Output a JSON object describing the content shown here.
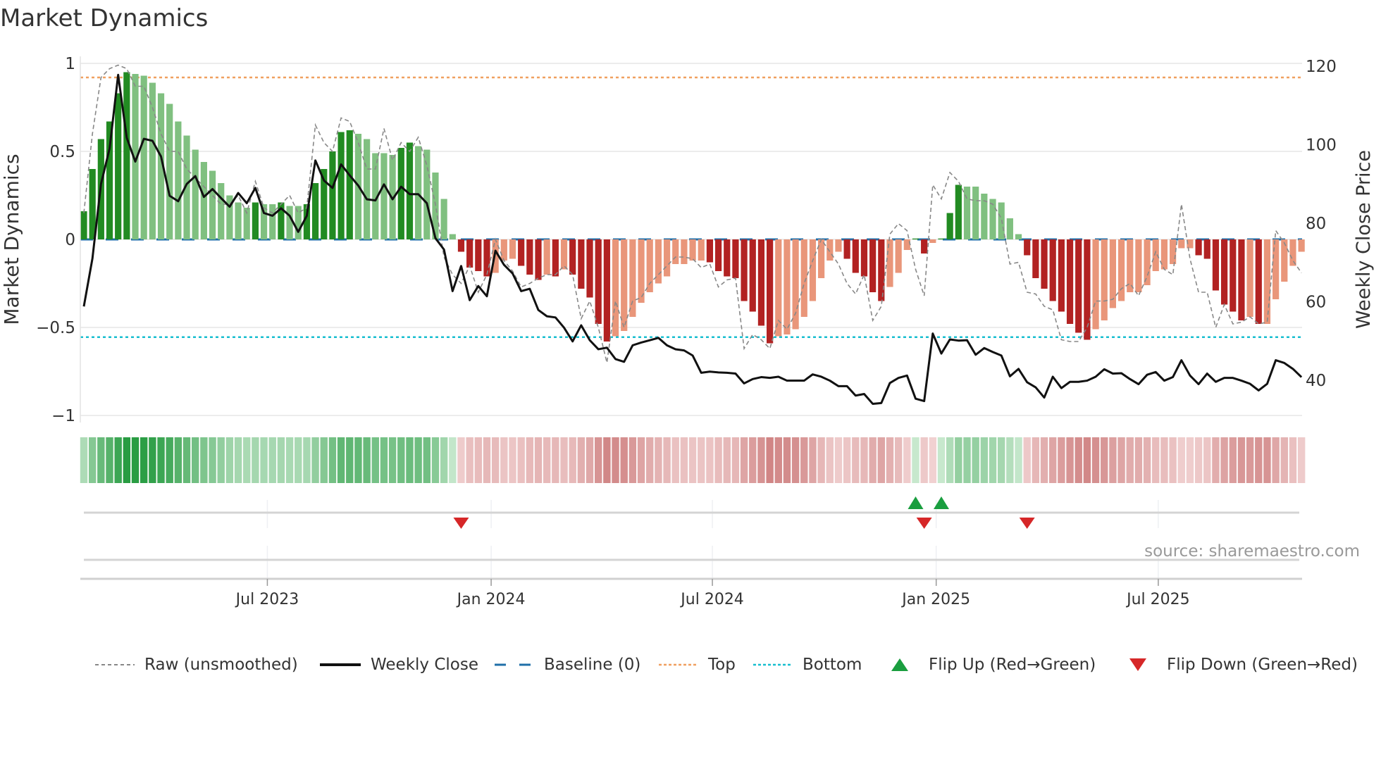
{
  "title": "Market Dynamics",
  "source": "source: sharemaestro.com",
  "legend": {
    "raw": "Raw (unsmoothed)",
    "close": "Weekly Close",
    "baseline": "Baseline (0)",
    "top": "Top",
    "bottom": "Bottom",
    "flip_up": "Flip Up (Red→Green)",
    "flip_down": "Flip Down (Green→Red)"
  },
  "colors": {
    "green_dark": "#228b22",
    "green_light": "#80c080",
    "red_dark": "#b22222",
    "red_light": "#e9967a",
    "top": "#f0a060",
    "bottom": "#17becf",
    "baseline": "#1f6fa8",
    "raw": "#888888",
    "close": "#111111",
    "flip_up": "#1a9e3f",
    "flip_down": "#d62728"
  },
  "chart_data": {
    "type": "bar",
    "title": "Market Dynamics",
    "xlabel": "",
    "ylabel": "Market Dynamics",
    "y2label": "Weekly Close Price",
    "ylim": [
      -1,
      1
    ],
    "y2lim": [
      40,
      120
    ],
    "yticks": [
      {
        "v": 1,
        "label": "1"
      },
      {
        "v": 0.5,
        "label": "0.5"
      },
      {
        "v": 0,
        "label": "0"
      },
      {
        "v": -0.5,
        "label": "−0.5"
      },
      {
        "v": -1,
        "label": "−1"
      }
    ],
    "y2ticks": [
      {
        "v": 120,
        "label": "120"
      },
      {
        "v": 100,
        "label": "100"
      },
      {
        "v": 80,
        "label": "80"
      },
      {
        "v": 60,
        "label": "60"
      },
      {
        "v": 40,
        "label": "40"
      }
    ],
    "xticks": [
      {
        "week": 21.4,
        "label": "Jul 2023"
      },
      {
        "week": 47.5,
        "label": "Jan 2024"
      },
      {
        "week": 73.3,
        "label": "Jul 2024"
      },
      {
        "week": 99.4,
        "label": "Jan 2025"
      },
      {
        "week": 125.3,
        "label": "Jul 2025"
      }
    ],
    "top_level": 0.92,
    "bottom_level": -0.555,
    "baseline": 0,
    "dynamics": [
      0.16,
      0.4,
      0.57,
      0.67,
      0.83,
      0.95,
      0.94,
      0.93,
      0.89,
      0.83,
      0.77,
      0.67,
      0.59,
      0.51,
      0.44,
      0.39,
      0.32,
      0.25,
      0.21,
      0.18,
      0.21,
      0.2,
      0.2,
      0.21,
      0.19,
      0.19,
      0.2,
      0.32,
      0.4,
      0.5,
      0.61,
      0.62,
      0.6,
      0.57,
      0.49,
      0.49,
      0.48,
      0.52,
      0.55,
      0.53,
      0.51,
      0.38,
      0.23,
      0.03,
      -0.07,
      -0.16,
      -0.18,
      -0.21,
      -0.19,
      -0.12,
      -0.11,
      -0.15,
      -0.2,
      -0.23,
      -0.2,
      -0.21,
      -0.17,
      -0.2,
      -0.28,
      -0.33,
      -0.48,
      -0.58,
      -0.55,
      -0.52,
      -0.44,
      -0.36,
      -0.3,
      -0.25,
      -0.21,
      -0.14,
      -0.14,
      -0.12,
      -0.12,
      -0.13,
      -0.18,
      -0.21,
      -0.22,
      -0.35,
      -0.41,
      -0.49,
      -0.59,
      -0.55,
      -0.54,
      -0.51,
      -0.44,
      -0.35,
      -0.22,
      -0.12,
      -0.07,
      -0.11,
      -0.19,
      -0.21,
      -0.3,
      -0.35,
      -0.27,
      -0.19,
      -0.06,
      0.005,
      -0.08,
      -0.02,
      0.005,
      0.15,
      0.31,
      0.3,
      0.3,
      0.26,
      0.23,
      0.21,
      0.12,
      0.03,
      -0.09,
      -0.22,
      -0.28,
      -0.35,
      -0.41,
      -0.48,
      -0.53,
      -0.57,
      -0.51,
      -0.46,
      -0.39,
      -0.35,
      -0.3,
      -0.3,
      -0.26,
      -0.18,
      -0.17,
      -0.14,
      -0.05,
      -0.05,
      -0.09,
      -0.11,
      -0.29,
      -0.37,
      -0.41,
      -0.46,
      -0.44,
      -0.48,
      -0.48,
      -0.34,
      -0.24,
      -0.15,
      -0.07
    ],
    "raw": [
      0.15,
      0.6,
      0.92,
      0.97,
      0.99,
      0.97,
      0.87,
      0.87,
      0.75,
      0.6,
      0.5,
      0.5,
      0.4,
      0.35,
      0.3,
      0.25,
      0.2,
      0.2,
      0.25,
      0.15,
      0.33,
      0.18,
      0.15,
      0.2,
      0.25,
      0.15,
      0.18,
      0.65,
      0.55,
      0.5,
      0.69,
      0.67,
      0.55,
      0.4,
      0.4,
      0.63,
      0.45,
      0.55,
      0.5,
      0.58,
      0.42,
      0.2,
      -0.1,
      -0.2,
      -0.25,
      -0.15,
      -0.3,
      -0.2,
      0.0,
      -0.12,
      -0.18,
      -0.27,
      -0.25,
      -0.22,
      -0.2,
      -0.2,
      -0.15,
      -0.2,
      -0.45,
      -0.35,
      -0.5,
      -0.7,
      -0.35,
      -0.5,
      -0.35,
      -0.33,
      -0.25,
      -0.2,
      -0.15,
      -0.1,
      -0.1,
      -0.11,
      -0.16,
      -0.14,
      -0.27,
      -0.23,
      -0.22,
      -0.62,
      -0.54,
      -0.57,
      -0.62,
      -0.46,
      -0.51,
      -0.42,
      -0.25,
      -0.12,
      0.0,
      -0.07,
      -0.14,
      -0.25,
      -0.31,
      -0.2,
      -0.46,
      -0.38,
      0.03,
      0.09,
      0.05,
      -0.17,
      -0.32,
      0.31,
      0.23,
      0.38,
      0.33,
      0.23,
      0.22,
      0.22,
      0.2,
      0.12,
      -0.14,
      -0.13,
      -0.3,
      -0.31,
      -0.38,
      -0.4,
      -0.57,
      -0.58,
      -0.58,
      -0.5,
      -0.35,
      -0.35,
      -0.34,
      -0.28,
      -0.25,
      -0.32,
      -0.21,
      -0.07,
      -0.17,
      -0.2,
      0.2,
      -0.11,
      -0.3,
      -0.3,
      -0.5,
      -0.37,
      -0.48,
      -0.47,
      -0.44,
      -0.48,
      -0.47,
      0.05,
      -0.02,
      -0.12,
      -0.19
    ],
    "close": [
      58.8,
      71,
      90,
      99,
      117.8,
      101.8,
      95.7,
      101.5,
      101,
      97,
      87,
      85.6,
      90,
      92,
      86.7,
      88.7,
      86.4,
      84.2,
      87.7,
      85.1,
      89,
      82.6,
      81.9,
      83.8,
      81.9,
      77.8,
      81.9,
      96,
      90.9,
      89,
      95,
      92.2,
      89.6,
      86.1,
      85.8,
      89.9,
      86.1,
      89.3,
      87.4,
      87.4,
      85.1,
      76.2,
      73.3,
      62.7,
      69.1,
      60.4,
      64,
      61.4,
      73,
      69.4,
      67.2,
      62.7,
      63.3,
      57.9,
      56.3,
      56,
      53.4,
      49.9,
      54,
      50.2,
      47.9,
      48.3,
      45.4,
      44.7,
      48.9,
      49.6,
      50.2,
      50.8,
      48.9,
      47.9,
      47.6,
      46.3,
      41.9,
      42.2,
      42,
      41.9,
      41.7,
      39.2,
      40.3,
      40.8,
      40.6,
      40.9,
      39.9,
      39.9,
      39.9,
      41.5,
      40.9,
      39.9,
      38.5,
      38.5,
      36.1,
      36.5,
      34,
      34.2,
      39.3,
      40.6,
      41.2,
      35.3,
      34.7,
      51.9,
      46.8,
      50.4,
      50.1,
      50.2,
      46.5,
      48.2,
      47.2,
      46.3,
      41,
      42.9,
      39.5,
      38.2,
      35.6,
      40.9,
      38,
      39.6,
      39.6,
      39.9,
      40.9,
      42.8,
      41.7,
      41.8,
      40.3,
      39,
      41.4,
      42.1,
      39.9,
      40.8,
      45.1,
      41.2,
      39,
      41.7,
      39.6,
      40.6,
      40.6,
      39.9,
      39.1,
      37.4,
      39.1,
      45.1,
      44.4,
      42.9,
      40.8
    ],
    "flips_up_week": [
      97,
      100
    ],
    "flips_down_week": [
      44,
      98,
      110
    ]
  }
}
